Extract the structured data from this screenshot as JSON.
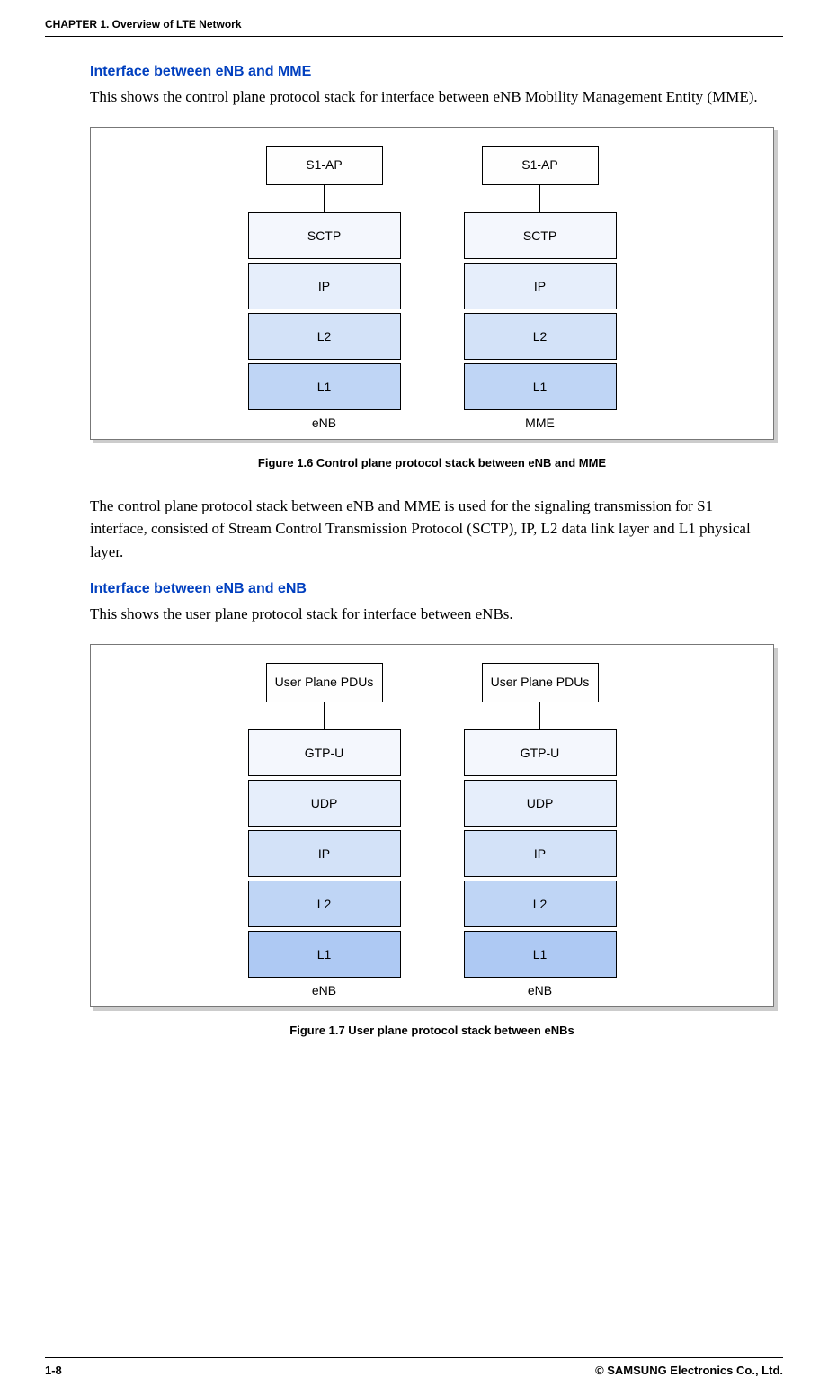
{
  "header": {
    "chapter": "CHAPTER 1. Overview of LTE Network"
  },
  "section1": {
    "title": "Interface between eNB and MME",
    "intro": "This shows the control plane protocol stack for interface between eNB Mobility Management Entity (MME).",
    "figure": {
      "left": {
        "top": "S1-AP",
        "layers": [
          "SCTP",
          "IP",
          "L2",
          "L1"
        ],
        "node": "eNB"
      },
      "right": {
        "top": "S1-AP",
        "layers": [
          "SCTP",
          "IP",
          "L2",
          "L1"
        ],
        "node": "MME"
      },
      "caption": "Figure 1.6    Control plane protocol stack between eNB and MME"
    },
    "after": "The control plane protocol stack between eNB and MME is used for the signaling transmission for S1 interface, consisted of Stream Control Transmission Protocol (SCTP), IP, L2 data link layer and L1 physical layer."
  },
  "section2": {
    "title": "Interface between eNB and eNB",
    "intro": "This shows the user plane protocol stack for interface between eNBs.",
    "figure": {
      "left": {
        "top": "User Plane PDUs",
        "layers": [
          "GTP-U",
          "UDP",
          "IP",
          "L2",
          "L1"
        ],
        "node": "eNB"
      },
      "right": {
        "top": "User Plane PDUs",
        "layers": [
          "GTP-U",
          "UDP",
          "IP",
          "L2",
          "L1"
        ],
        "node": "eNB"
      },
      "caption": "Figure 1.7    User plane protocol stack between eNBs"
    }
  },
  "footer": {
    "page": "1-8",
    "copyright": "© SAMSUNG Electronics Co., Ltd."
  },
  "chart_data": [
    {
      "type": "table",
      "title": "Control plane protocol stack between eNB and MME",
      "columns": [
        "eNB",
        "MME"
      ],
      "rows": [
        [
          "S1-AP",
          "S1-AP"
        ],
        [
          "SCTP",
          "SCTP"
        ],
        [
          "IP",
          "IP"
        ],
        [
          "L2",
          "L2"
        ],
        [
          "L1",
          "L1"
        ]
      ]
    },
    {
      "type": "table",
      "title": "User plane protocol stack between eNBs",
      "columns": [
        "eNB",
        "eNB"
      ],
      "rows": [
        [
          "User Plane PDUs",
          "User Plane PDUs"
        ],
        [
          "GTP-U",
          "GTP-U"
        ],
        [
          "UDP",
          "UDP"
        ],
        [
          "IP",
          "IP"
        ],
        [
          "L2",
          "L2"
        ],
        [
          "L1",
          "L1"
        ]
      ]
    }
  ]
}
